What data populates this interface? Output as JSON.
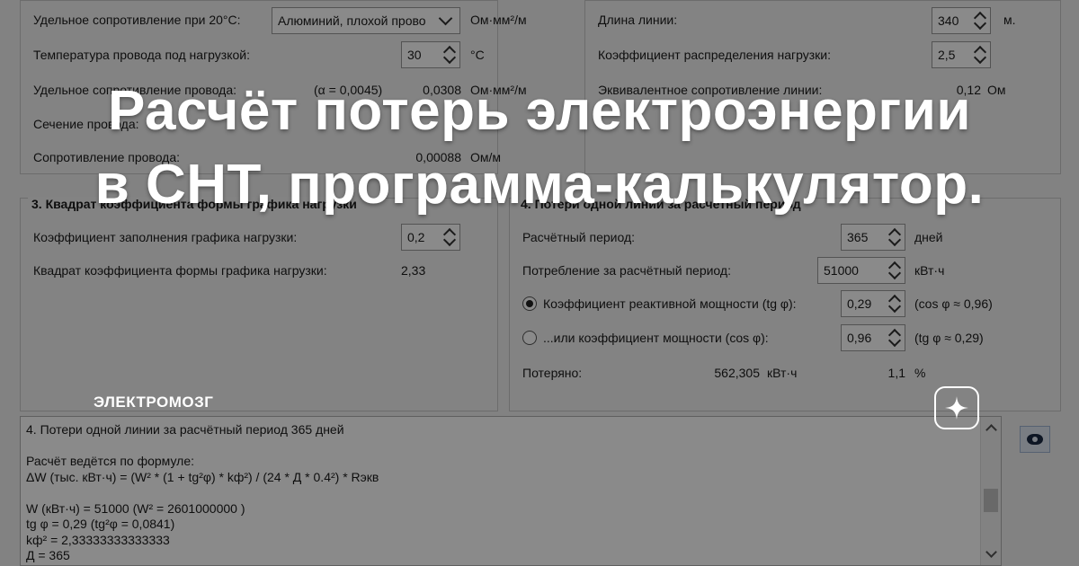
{
  "wire": {
    "resistivity_label": "Удельное сопротивление при 20°С:",
    "resistivity_material": "Алюминий, плохой прово",
    "resistivity_unit": "Ом·мм²/м",
    "temp_label": "Температура провода под нагрузкой:",
    "temp_value": "30",
    "temp_unit": "°С",
    "resistivity_hot_label": "Удельное сопротивление провода:",
    "alpha_text": "(α = 0,0045)",
    "resistivity_hot_value": "0,0308",
    "resistivity_hot_unit": "Ом·мм²/м",
    "section_label": "Сечение провода:",
    "wire_resistance_label": "Сопротивление провода:",
    "wire_resistance_value": "0,00088",
    "wire_resistance_unit": "Ом/м"
  },
  "line": {
    "length_label": "Длина линии:",
    "length_value": "340",
    "length_unit": "м.",
    "load_coef_label": "Коэффициент распределения нагрузки:",
    "load_coef_value": "2,5",
    "equiv_label": "Эквивалентное сопротивление линии:",
    "equiv_value": "0,12",
    "equiv_unit": "Ом"
  },
  "form_factor": {
    "title": "3. Квадрат коэффициента формы графика нагрузки",
    "fill_label": "Коэффициент заполнения графика нагрузки:",
    "fill_value": "0,2",
    "square_label": "Квадрат коэффициента формы графика нагрузки:",
    "square_value": "2,33"
  },
  "losses": {
    "title": "4. Потери одной линии за расчетный период",
    "period_label": "Расчётный период:",
    "period_value": "365",
    "period_unit": "дней",
    "consumption_label": "Потребление за расчётный период:",
    "consumption_value": "51000",
    "consumption_unit": "кВт·ч",
    "reactive_label": "Коэффициент реактивной мощности (tg φ):",
    "reactive_value": "0,29",
    "reactive_note": "(cos φ ≈ 0,96)",
    "cos_label": "...или коэффициент мощности (cos φ):",
    "cos_value": "0,96",
    "cos_note": "(tg φ ≈ 0,29)",
    "lost_label": "Потеряно:",
    "lost_value": "562,305",
    "lost_unit": "кВт·ч",
    "lost_percent": "1,1",
    "percent_sign": "%"
  },
  "log": {
    "line1": "4. Потери одной линии за расчётный период 365 дней",
    "line2": "",
    "line3": "Расчёт ведётся по формуле:",
    "line4": "ΔW (тыс. кВт·ч) = (W² * (1 + tg²φ) * kф²) / (24 * Д * 0.4²) * Rэкв",
    "line5": "",
    "line6": "W (кВт·ч) = 51000 (W² = 2601000000 )",
    "line7": "tg φ = 0,29 (tg²φ = 0,0841)",
    "line8": "kф² = 2,33333333333333",
    "line9": "Д = 365"
  },
  "banner": {
    "headline_1": "Расчёт потерь электроэнергии",
    "headline_2": "в СНТ, программа-калькулятор.",
    "brand": "ЭЛЕКТРОМОЗГ"
  },
  "icons": {
    "eye": "eye-icon",
    "brand_badge": "sparkle-icon"
  }
}
